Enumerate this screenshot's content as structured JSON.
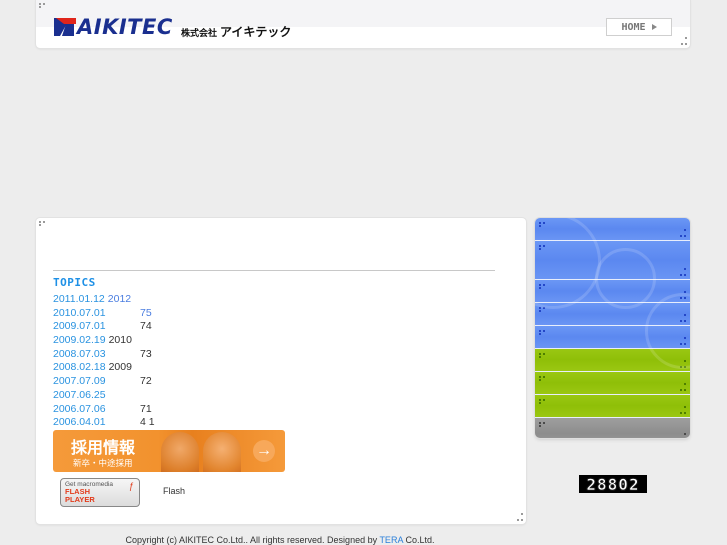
{
  "header": {
    "logo_text": "AIKITEC",
    "company_prefix": "株式会社",
    "company_name": "アイキテック",
    "home_label": "HOME"
  },
  "topics": {
    "title": "TOPICS",
    "items": [
      {
        "date": "2011.01.12",
        "note": "2012",
        "note_style": "blue-inline"
      },
      {
        "date": "2010.07.01",
        "note": "75",
        "note_style": "blue-col"
      },
      {
        "date": "2009.07.01",
        "note": "74",
        "note_style": "col"
      },
      {
        "date": "2009.02.19",
        "note": "2010",
        "note_style": "inline"
      },
      {
        "date": "2008.07.03",
        "note": "73",
        "note_style": "col"
      },
      {
        "date": "2008.02.18",
        "note": "2009",
        "note_style": "inline"
      },
      {
        "date": "2007.07.09",
        "note": "72",
        "note_style": "col"
      },
      {
        "date": "2007.06.25",
        "note": "",
        "note_style": "col"
      },
      {
        "date": "2006.07.06",
        "note": "71",
        "note_style": "col"
      },
      {
        "date": "2006.04.01",
        "note": "4 1",
        "note_style": "col"
      }
    ]
  },
  "recruit_banner": {
    "title": "採用情報",
    "subtitle": "新卒・中途採用",
    "arrow": "→"
  },
  "flash": {
    "badge_line1": "Get macromedia",
    "badge_line2": "FLASH",
    "badge_line3": "PLAYER",
    "label": "Flash"
  },
  "sidenav": {
    "items": [
      {
        "color": "blue"
      },
      {
        "color": "blue"
      },
      {
        "color": "blue"
      },
      {
        "color": "blue"
      },
      {
        "color": "blue"
      },
      {
        "color": "green"
      },
      {
        "color": "green"
      },
      {
        "color": "green"
      },
      {
        "color": "gray"
      }
    ],
    "colors": {
      "blue": "#6690f4",
      "green": "#95c40e",
      "gray": "#959595"
    }
  },
  "counter": {
    "value": "28802"
  },
  "footer": {
    "copyright": "Copyright (c) AIKITEC Co.Ltd.. All rights reserved. Designed by",
    "designer_link": "TERA",
    "suffix": "Co.Ltd."
  }
}
